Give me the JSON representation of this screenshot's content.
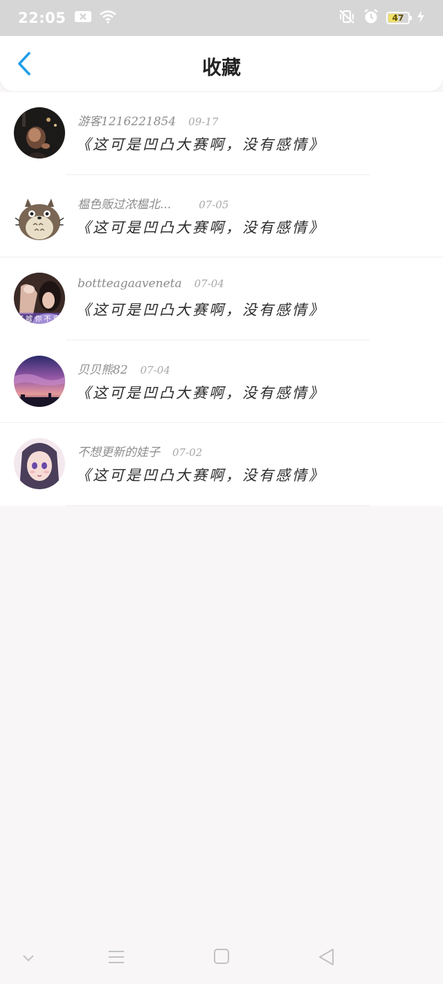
{
  "status_bar": {
    "time": "22:05",
    "battery_level": "47",
    "battery_fraction": 0.47,
    "icons": [
      "message-icon",
      "wifi-icon",
      "vibrate-icon",
      "alarm-icon",
      "battery-icon",
      "charging-icon"
    ]
  },
  "header": {
    "title": "收藏",
    "back_icon": "chevron-left-icon",
    "accent": "#1f9ee8"
  },
  "favorites": [
    {
      "user": "游客1216221854",
      "date": "09-17",
      "title": "《这可是凹凸大赛啊，没有感情》"
    },
    {
      "user": "榅色贩过浓榅北...",
      "date": "07-05",
      "title": "《这可是凹凸大赛啊，没有感情》"
    },
    {
      "user": "bottteagaaveneta",
      "date": "07-04",
      "title": "《这可是凹凸大赛啊，没有感情》"
    },
    {
      "user": "贝贝熊82",
      "date": "07-04",
      "title": "《这可是凹凸大赛啊，没有感情》"
    },
    {
      "user": "不想更新的娃子",
      "date": "07-02",
      "title": "《这可是凹凸大赛啊，没有感情》"
    }
  ],
  "nav_bar": {
    "icons": [
      "chevron-down-icon",
      "menu-icon",
      "home-square-icon",
      "back-triangle-icon"
    ]
  }
}
